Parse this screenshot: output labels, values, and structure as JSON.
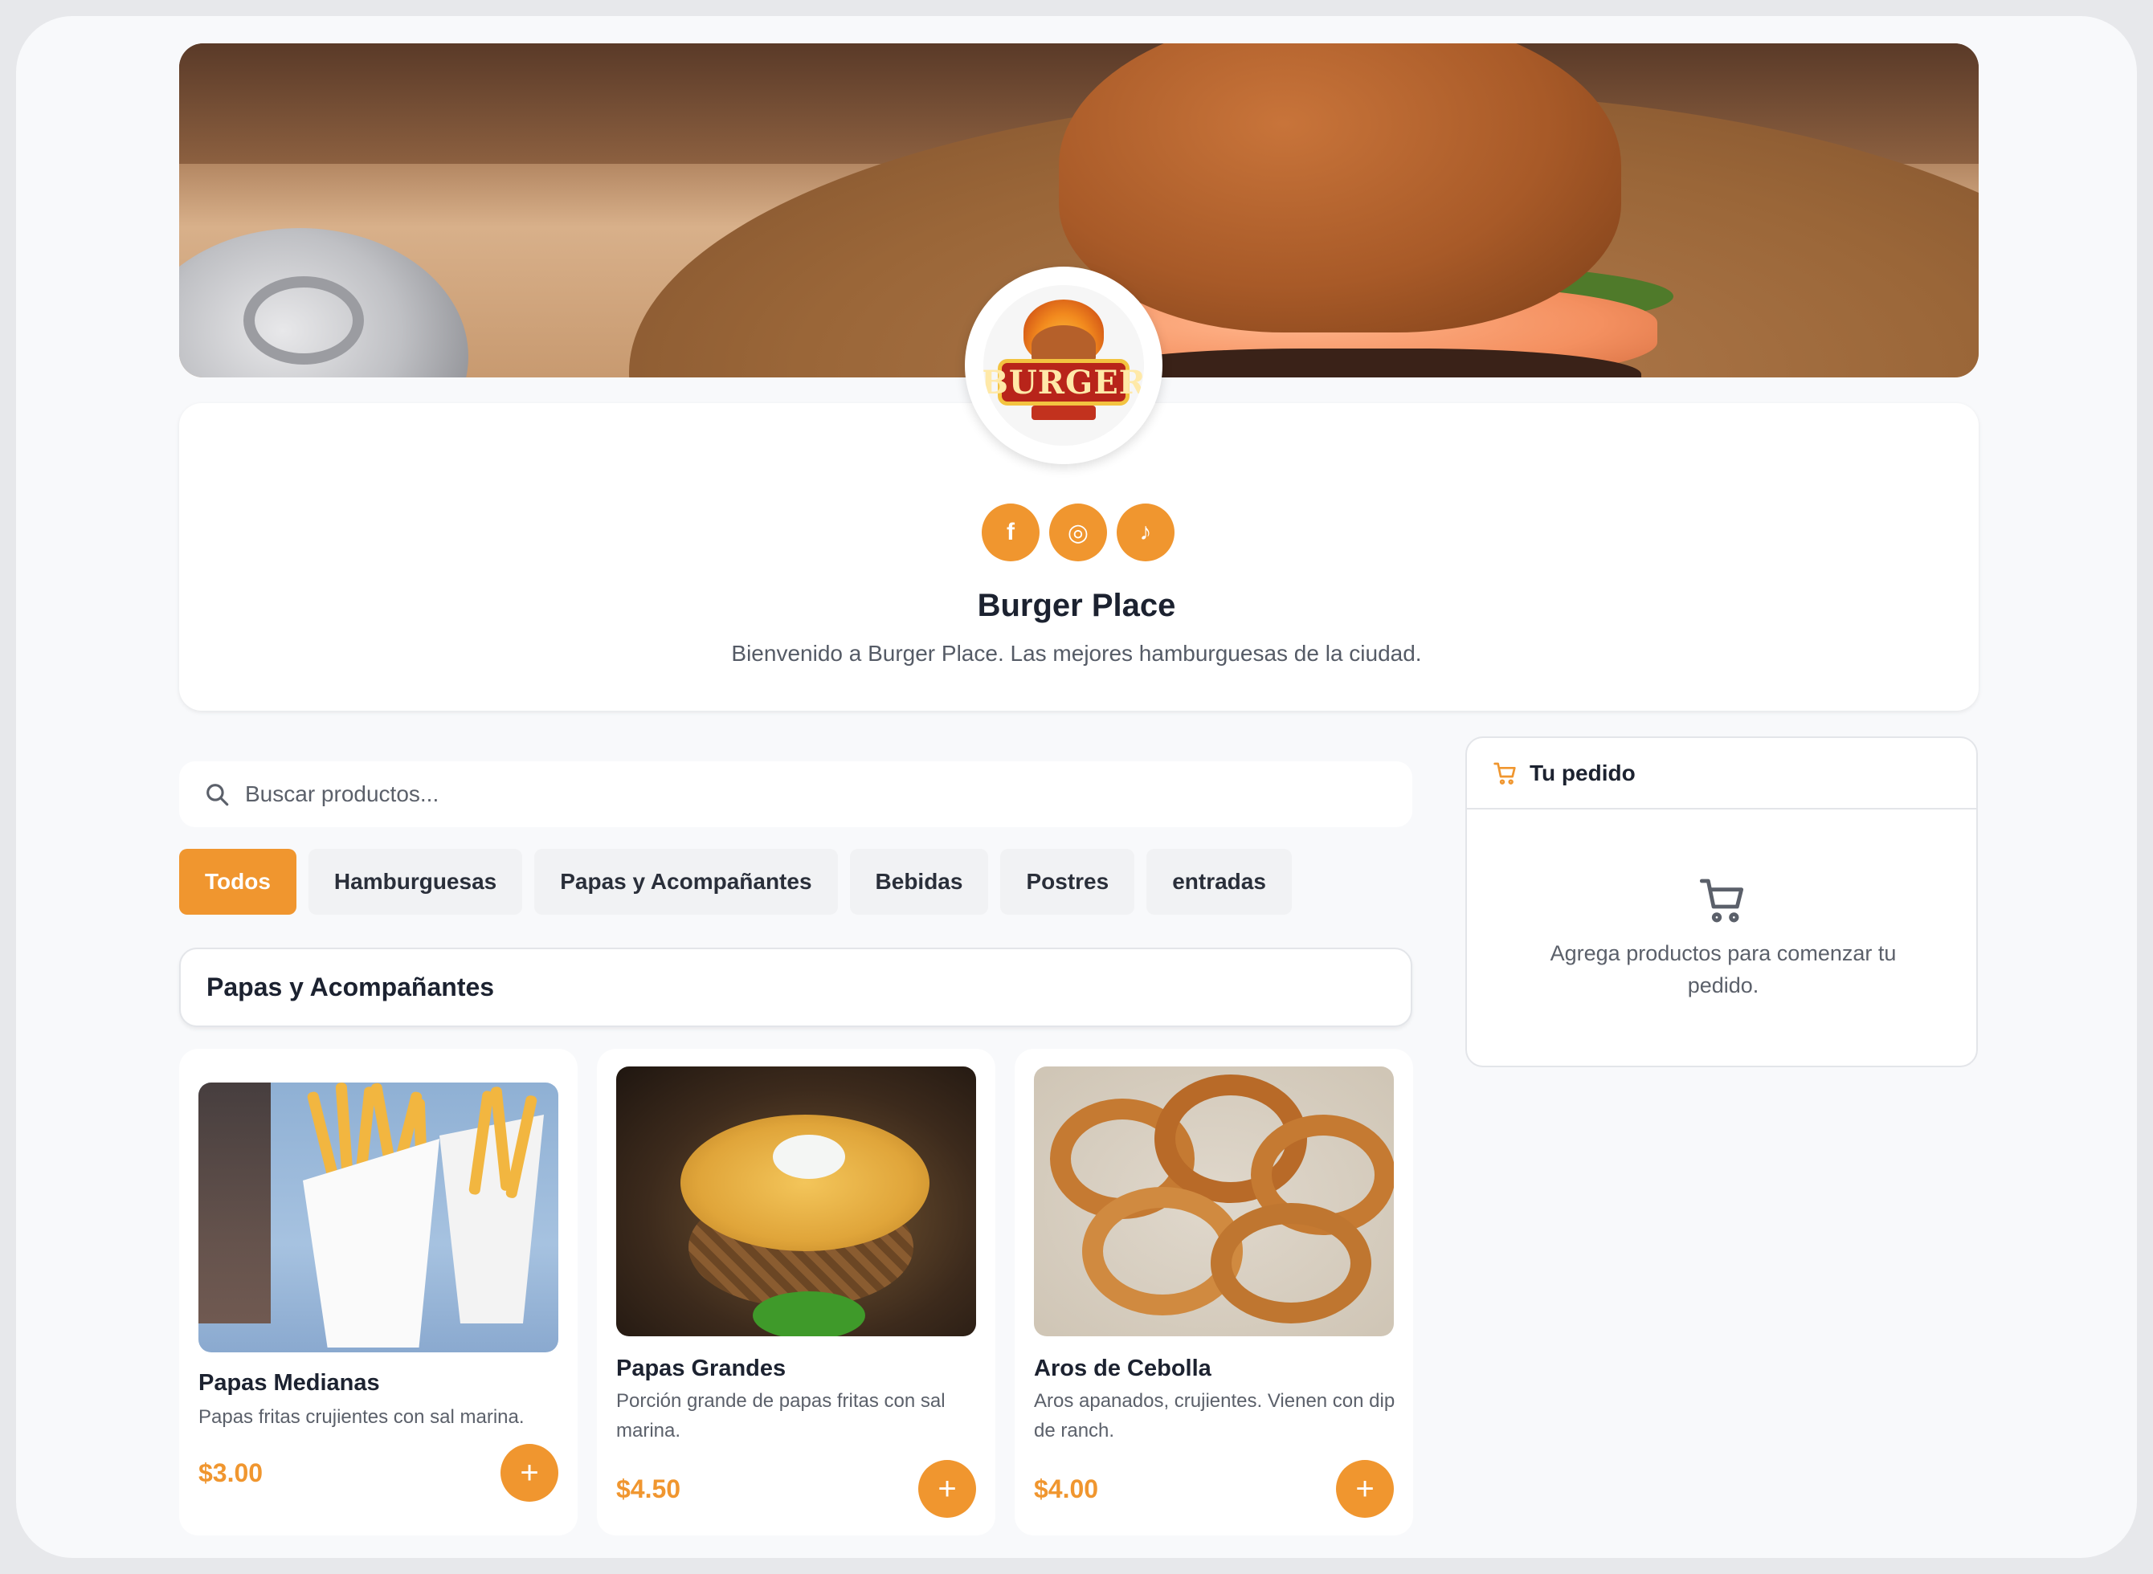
{
  "brand": {
    "name": "Burger Place",
    "description": "Bienvenido a Burger Place. Las mejores hamburguesas de la ciudad.",
    "logo_text": "BURGER",
    "accent_color": "#f0962f"
  },
  "socials": [
    {
      "icon": "facebook-icon",
      "glyph": "f"
    },
    {
      "icon": "instagram-icon",
      "glyph": "◎"
    },
    {
      "icon": "tiktok-icon",
      "glyph": "♪"
    }
  ],
  "search": {
    "placeholder": "Buscar productos..."
  },
  "categories": [
    {
      "label": "Todos",
      "active": true
    },
    {
      "label": "Hamburguesas",
      "active": false
    },
    {
      "label": "Papas y Acompañantes",
      "active": false
    },
    {
      "label": "Bebidas",
      "active": false
    },
    {
      "label": "Postres",
      "active": false
    },
    {
      "label": "entradas",
      "active": false
    }
  ],
  "section": {
    "title": "Papas y Acompañantes"
  },
  "products": [
    {
      "name": "Papas Medianas",
      "description": "Papas fritas crujientes con sal marina.",
      "price": "$3.00",
      "add_label": "+"
    },
    {
      "name": "Papas Grandes",
      "description": "Porción grande de papas fritas con sal marina.",
      "price": "$4.50",
      "add_label": "+"
    },
    {
      "name": "Aros de Cebolla",
      "description": "Aros apanados, crujientes. Vienen con dip de ranch.",
      "price": "$4.00",
      "add_label": "+"
    }
  ],
  "cart": {
    "title": "Tu pedido",
    "empty_message": "Agrega productos para comenzar tu pedido."
  }
}
